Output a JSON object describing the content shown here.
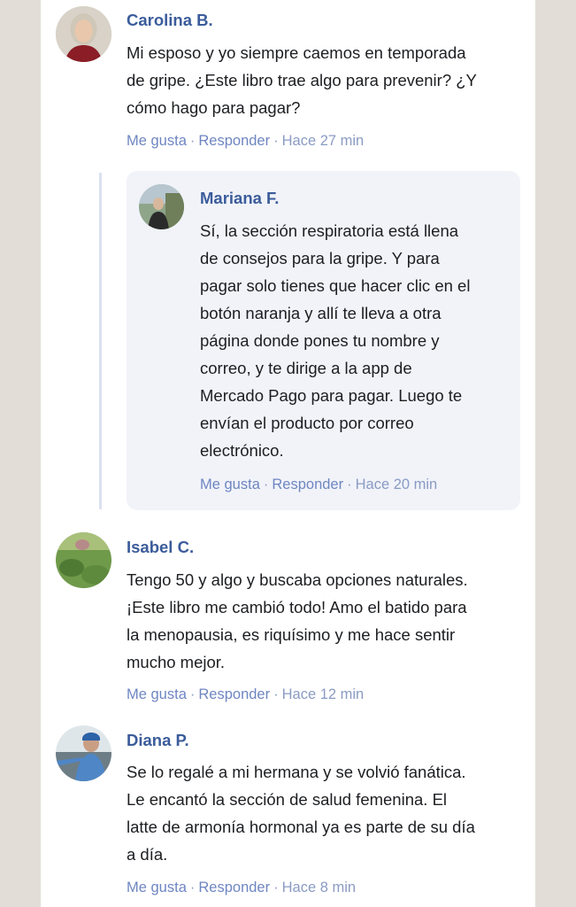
{
  "actions": {
    "like": "Me gusta",
    "reply": "Responder",
    "separator": "·"
  },
  "comments": [
    {
      "author": "Carolina B.",
      "lines": [
        "Mi esposo y yo siempre caemos en temporada",
        "de gripe. ¿Este libro trae algo para prevenir? ¿Y",
        "cómo hago para pagar?"
      ],
      "time": "Hace 27 min"
    },
    {
      "author": "Mariana F.",
      "lines": [
        "Sí, la sección respiratoria está llena",
        "de consejos para la gripe. Y para",
        "pagar solo tienes que hacer clic en el",
        "botón naranja y allí te lleva a otra",
        "página donde pones tu nombre y",
        "correo, y te dirige a la app de",
        "Mercado Pago para pagar. Luego te",
        "envían el producto por correo",
        "electrónico."
      ],
      "time": "Hace 20 min"
    },
    {
      "author": "Isabel C.",
      "lines": [
        "Tengo 50 y algo y buscaba opciones naturales.",
        "¡Este libro me cambió todo! Amo el batido para",
        "la menopausia, es riquísimo y me hace sentir",
        "mucho mejor."
      ],
      "time": "Hace 12 min"
    },
    {
      "author": "Diana P.",
      "lines": [
        "Se lo regalé a mi hermana y se volvió fanática.",
        "Le encantó la sección de salud femenina. El",
        "latte de armonía hormonal ya es parte de su día",
        "a día."
      ],
      "time": "Hace 8 min"
    }
  ]
}
